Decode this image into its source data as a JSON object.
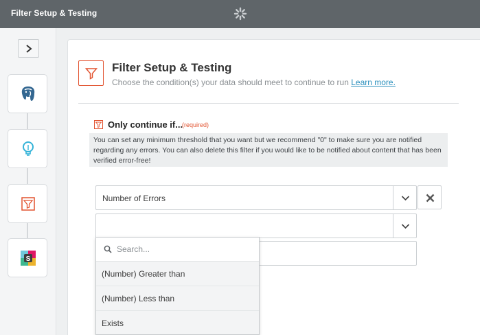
{
  "topbar": {
    "title": "Filter Setup & Testing",
    "spinner_icon": "loading-spinner-icon"
  },
  "sidebar": {
    "toggle_icon": "chevron-right-icon",
    "steps": [
      {
        "icon": "postgresql-icon"
      },
      {
        "icon": "lightbulb-icon"
      },
      {
        "icon": "filter-icon",
        "color": "#e2522f"
      },
      {
        "icon": "slack-icon"
      }
    ]
  },
  "main": {
    "title": "Filter Setup & Testing",
    "subtitle": "Choose the condition(s) your data should meet to continue to run",
    "learn_more": "Learn more.",
    "condition": {
      "label": "Only continue if...",
      "required": "(required)",
      "help": "You can set any minimum threshold that you want but we recommend \"0\" to make sure you are notified regarding any errors. You can also delete this filter if you would like to be notified about content that has been verified error-free!"
    },
    "field_value": "Number of Errors",
    "operator_value": "",
    "value_field": ""
  },
  "dropdown": {
    "search_placeholder": "Search...",
    "options": [
      "(Number) Greater than",
      "(Number) Less than",
      "Exists"
    ]
  },
  "colors": {
    "accent": "#e2522f",
    "topbar": "#5f6569",
    "link": "#2a8fbd"
  }
}
